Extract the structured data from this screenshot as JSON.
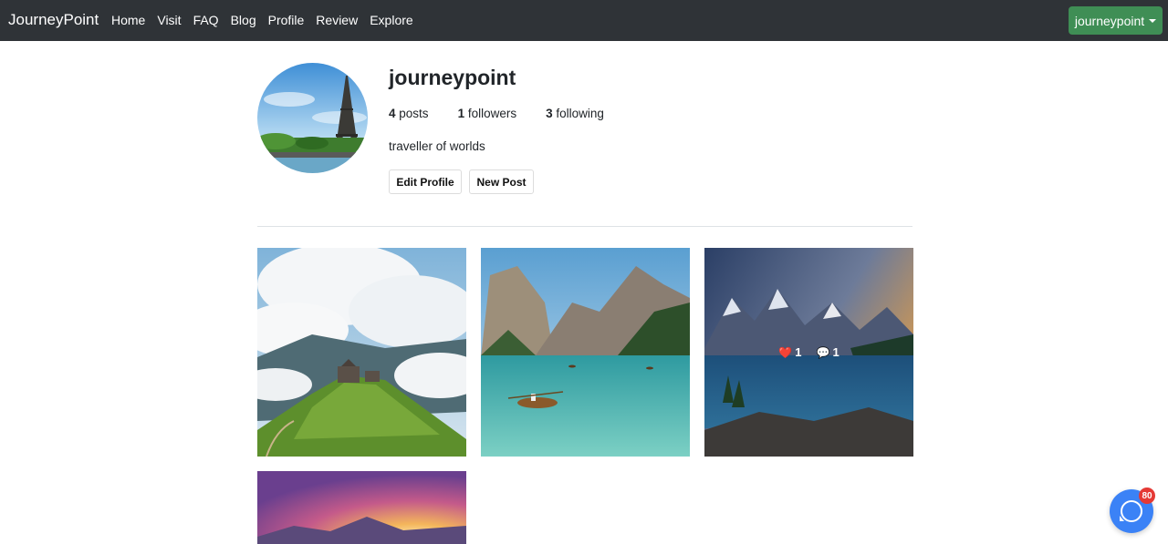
{
  "navbar": {
    "brand": "JourneyPoint",
    "links": [
      "Home",
      "Visit",
      "FAQ",
      "Blog",
      "Profile",
      "Review",
      "Explore"
    ],
    "user_menu": "journeypoint"
  },
  "profile": {
    "username": "journeypoint",
    "stats": {
      "posts_count": "4",
      "posts_label": "posts",
      "followers_count": "1",
      "followers_label": "followers",
      "following_count": "3",
      "following_label": "following"
    },
    "bio": "traveller of worlds",
    "edit_button": "Edit Profile",
    "new_post_button": "New Post"
  },
  "posts": [
    {
      "scene": "mountain-church-clouds"
    },
    {
      "scene": "lake-rowboat-dolomites"
    },
    {
      "scene": "mountain-lake-sunset",
      "likes": "1",
      "comments": "1"
    },
    {
      "scene": "sunset-mountains"
    }
  ],
  "chat": {
    "badge": "80"
  },
  "icons": {
    "like": "heart-icon",
    "comment": "speech-bubble-icon",
    "chat": "chat-icon"
  },
  "colors": {
    "navbar": "#2f3337",
    "user_button": "#3f8e55",
    "chat": "#3b82f6",
    "badge": "#e53935"
  }
}
